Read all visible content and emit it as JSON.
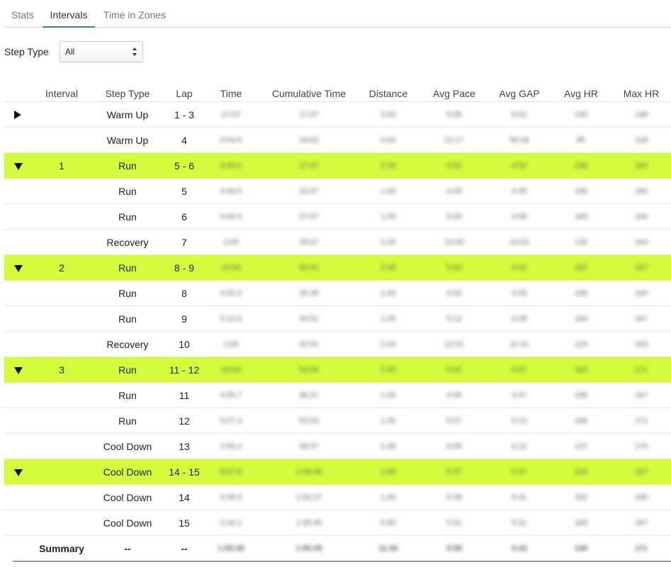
{
  "tabs": [
    {
      "label": "Stats",
      "active": false
    },
    {
      "label": "Intervals",
      "active": true
    },
    {
      "label": "Time in Zones",
      "active": false
    }
  ],
  "filter": {
    "label": "Step Type",
    "value": "All"
  },
  "columns": [
    "",
    "Interval",
    "Step Type",
    "Lap",
    "Time",
    "Cumulative Time",
    "Distance",
    "Avg Pace",
    "Avg GAP",
    "Avg HR",
    "Max HR"
  ],
  "rows": [
    {
      "toggle": "right",
      "highlight": false,
      "interval": "",
      "step_type": "Warm Up",
      "lap": "1 - 3",
      "values": [
        "17:07",
        "17:07",
        "3.00",
        "5:55",
        "6:01",
        "130",
        "148"
      ]
    },
    {
      "toggle": "",
      "highlight": false,
      "interval": "",
      "step_type": "Warm Up",
      "lap": "4",
      "values": [
        "0:04.5",
        "19:02",
        "0.00",
        "21:17",
        "50:16",
        "85",
        "126"
      ]
    },
    {
      "toggle": "down",
      "highlight": true,
      "interval": "1",
      "step_type": "Run",
      "lap": "5 - 6",
      "values": [
        "9:40.2",
        "27:07",
        "2.00",
        "4:52",
        "4:52",
        "158",
        "164"
      ]
    },
    {
      "toggle": "",
      "highlight": false,
      "interval": "",
      "step_type": "Run",
      "lap": "5",
      "values": [
        "4:44.5",
        "22:07",
        "1.00",
        "4:45",
        "4:45",
        "156",
        "160"
      ]
    },
    {
      "toggle": "",
      "highlight": false,
      "interval": "",
      "step_type": "Run",
      "lap": "6",
      "values": [
        "5:00.4",
        "27:07",
        "1.00",
        "5:00",
        "4:59",
        "160",
        "164"
      ]
    },
    {
      "toggle": "",
      "highlight": false,
      "interval": "",
      "step_type": "Recovery",
      "lap": "7",
      "values": [
        "2:00",
        "29:07",
        "0.20",
        "10:00",
        "10:20",
        "120",
        "164"
      ]
    },
    {
      "toggle": "down",
      "highlight": true,
      "interval": "2",
      "step_type": "Run",
      "lap": "8 - 9",
      "values": [
        "10:04",
        "40:51",
        "2.00",
        "5:02",
        "5:01",
        "161",
        "167"
      ]
    },
    {
      "toggle": "",
      "highlight": false,
      "interval": "",
      "step_type": "Run",
      "lap": "8",
      "values": [
        "4:52.2",
        "35:39",
        "1.00",
        "4:52",
        "4:55",
        "156",
        "164"
      ]
    },
    {
      "toggle": "",
      "highlight": false,
      "interval": "",
      "step_type": "Run",
      "lap": "9",
      "values": [
        "5:12.0",
        "40:51",
        "1.00",
        "5:12",
        "5:08",
        "164",
        "167"
      ]
    },
    {
      "toggle": "",
      "highlight": false,
      "interval": "",
      "step_type": "Recovery",
      "lap": "10",
      "values": [
        "2:00",
        "42:51",
        "0.24",
        "12:01",
        "11:41",
        "124",
        "163"
      ]
    },
    {
      "toggle": "down",
      "highlight": true,
      "interval": "3",
      "step_type": "Run",
      "lap": "11 - 12",
      "values": [
        "10:03",
        "52:54",
        "2.00",
        "5:02",
        "5:07",
        "162",
        "171"
      ]
    },
    {
      "toggle": "",
      "highlight": false,
      "interval": "",
      "step_type": "Run",
      "lap": "11",
      "values": [
        "4:55.7",
        "48:47",
        "1.00",
        "4:55",
        "4:57",
        "158",
        "167"
      ]
    },
    {
      "toggle": "",
      "highlight": false,
      "interval": "",
      "step_type": "Run",
      "lap": "12",
      "values": [
        "5:07.3",
        "53:54",
        "1.00",
        "5:07",
        "5:13",
        "166",
        "171"
      ]
    },
    {
      "toggle": "",
      "highlight": false,
      "interval": "",
      "step_type": "Cool Down",
      "lap": "13",
      "values": [
        "2:53.4",
        "56:47",
        "0.48",
        "6:05",
        "6:12",
        "137",
        "170"
      ]
    },
    {
      "toggle": "down",
      "highlight": true,
      "interval": "",
      "step_type": "Cool Down",
      "lap": "14 - 15",
      "values": [
        "8:57.6",
        "1:05:45",
        "1.60",
        "5:37",
        "5:37",
        "154",
        "167"
      ]
    },
    {
      "toggle": "",
      "highlight": false,
      "interval": "",
      "step_type": "Cool Down",
      "lap": "14",
      "values": [
        "5:39.0",
        "1:02:27",
        "1.00",
        "5:39",
        "5:41",
        "152",
        "166"
      ]
    },
    {
      "toggle": "",
      "highlight": false,
      "interval": "",
      "step_type": "Cool Down",
      "lap": "15",
      "values": [
        "3:18.1",
        "1:05:45",
        "0.60",
        "5:31",
        "5:31",
        "160",
        "167"
      ]
    }
  ],
  "summary": {
    "label": "Summary",
    "step_type": "--",
    "lap": "--",
    "values": [
      "1:05:45",
      "1:05:45",
      "11.00",
      "5:59",
      "5:42",
      "146",
      "171"
    ]
  },
  "colors": {
    "highlight": "#d4fc3c",
    "active_tab_underline": "#2a7fc9"
  }
}
